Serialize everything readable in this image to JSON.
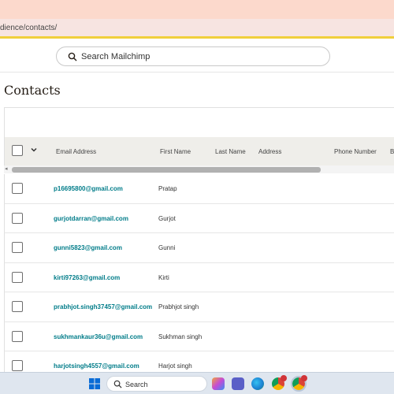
{
  "browser": {
    "url": "dience/contacts/"
  },
  "header": {
    "search_label": "Search Mailchimp"
  },
  "page": {
    "title": "Contacts"
  },
  "table": {
    "columns": [
      "Email Address",
      "First Name",
      "Last Name",
      "Address",
      "Phone Number",
      "B"
    ],
    "rows": [
      {
        "email": "p16695800@gmail.com",
        "first_name": "Pratap"
      },
      {
        "email": "gurjotdarran@gmail.com",
        "first_name": "Gurjot"
      },
      {
        "email": "gunni5823@gmail.com",
        "first_name": "Gunni"
      },
      {
        "email": "kirti97263@gmail.com",
        "first_name": "Kirti"
      },
      {
        "email": "prabhjot.singh37457@gmail.com",
        "first_name": "Prabhjot singh"
      },
      {
        "email": "sukhmankaur36u@gmail.com",
        "first_name": "Sukhman singh"
      },
      {
        "email": "harjotsingh4557@gmail.com",
        "first_name": "Harjot singh"
      }
    ]
  },
  "taskbar": {
    "search_label": "Search",
    "apps": [
      "copilot-icon",
      "teams-icon",
      "edge-icon",
      "chrome-icon",
      "chrome-profile-icon"
    ]
  },
  "colors": {
    "accent_link": "#007c89",
    "header_row": "#efeeea",
    "top_band": "#fcd9cc",
    "url_band": "#f7e4e1",
    "yellow_line": "#f0cf3c"
  }
}
